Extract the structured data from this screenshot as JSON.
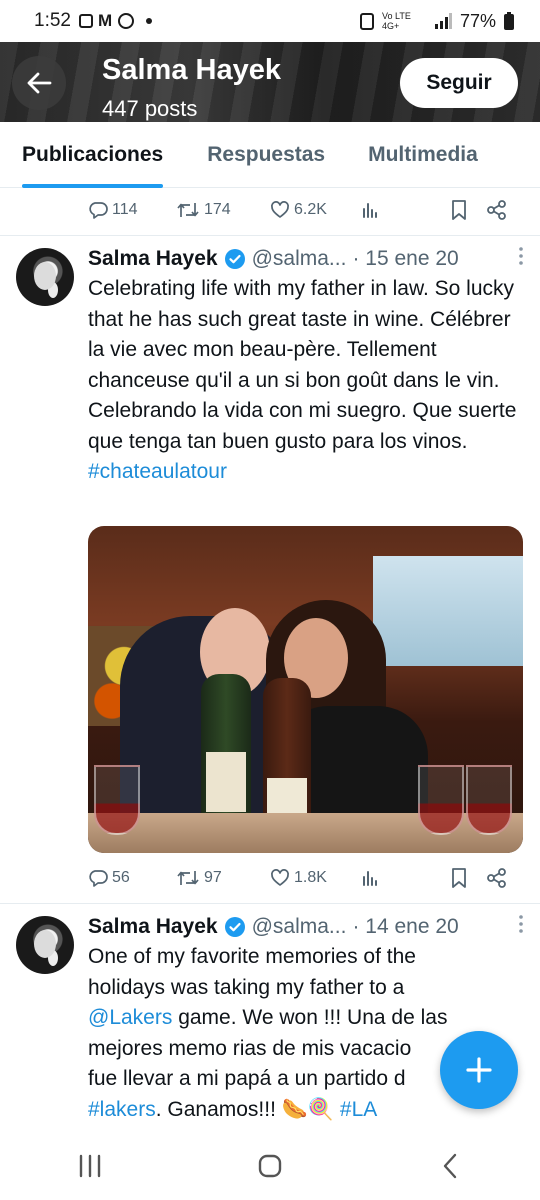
{
  "status_bar": {
    "time": "1:52",
    "network": "Vo LTE 4G+",
    "battery": "77%"
  },
  "header": {
    "profile_name": "Salma Hayek",
    "posts_count": "447 posts",
    "follow_label": "Seguir"
  },
  "tabs": [
    {
      "label": "Publicaciones",
      "active": true
    },
    {
      "label": "Respuestas",
      "active": false
    },
    {
      "label": "Multimedia",
      "active": false
    }
  ],
  "tweets": [
    {
      "metrics": {
        "replies": "114",
        "retweets": "174",
        "likes": "6.2K"
      }
    },
    {
      "author": "Salma Hayek",
      "handle": "@salma...",
      "date": "· 15 ene 20",
      "text": "Celebrating life with my father in law. So lucky that he has such great taste in wine. Célébrer la vie avec mon beau-père. Tellement chanceuse qu'il a un si bon goût dans le vin. Celebrando la vida con mi suegro. Que suerte que tenga tan buen gusto para los vinos.",
      "hashtag": "#chateaulatour",
      "metrics": {
        "replies": "56",
        "retweets": "97",
        "likes": "1.8K"
      }
    },
    {
      "author": "Salma Hayek",
      "handle": "@salma...",
      "date": "· 14 ene 20",
      "line1": "One of my favorite memories of the",
      "line2": "holidays was taking my father to a",
      "mention": "@Lakers",
      "line3_rest": " game. We won !!! Una de las",
      "line4": "mejores memo rias de mis vacacio",
      "line5": "fue llevar a mi papá a un partido d",
      "hashtag1": "#lakers",
      "line6_mid": ". Ganamos!!! 🌭🍭 ",
      "hashtag2": "#LA"
    }
  ],
  "colors": {
    "accent": "#1d9bf0",
    "link": "#1d8cd8",
    "text": "#0f1419",
    "muted": "#536471"
  },
  "icons": [
    "back-arrow-icon",
    "reply-icon",
    "retweet-icon",
    "like-icon",
    "views-icon",
    "bookmark-icon",
    "share-icon",
    "verified-icon",
    "more-icon",
    "compose-plus-icon",
    "nav-recents-icon",
    "nav-home-icon",
    "nav-back-icon"
  ]
}
